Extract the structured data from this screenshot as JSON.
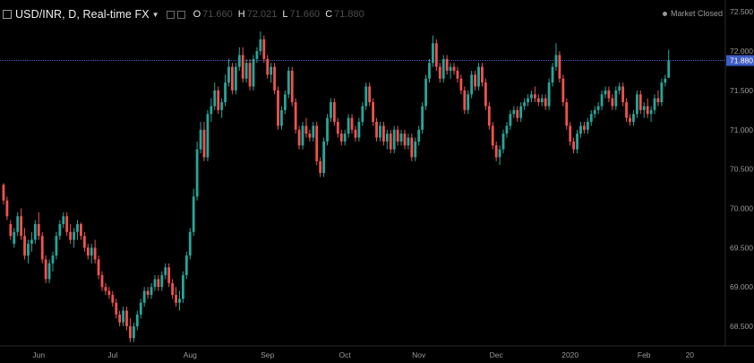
{
  "header": {
    "symbol": "USD/INR, D, Real-time FX",
    "open_label": "O",
    "open": "71.660",
    "high_label": "H",
    "high": "72.021",
    "low_label": "L",
    "low": "71.660",
    "close_label": "C",
    "close": "71.880",
    "status": "Market Closed"
  },
  "colors": {
    "up": "#26a69a",
    "down": "#ef5350",
    "background": "#000000",
    "price_line": "#4a60c8",
    "price_tag": "#3d5cc4"
  },
  "chart_data": {
    "type": "candlestick",
    "ylim": [
      68.25,
      72.65
    ],
    "y_ticks": [
      72.5,
      72.0,
      71.5,
      71.0,
      70.5,
      70.0,
      69.5,
      69.0,
      68.5
    ],
    "y_tick_labels": [
      "72.500",
      "72.000",
      "71.500",
      "71.000",
      "70.500",
      "70.000",
      "69.500",
      "69.000",
      "68.500"
    ],
    "x_labels": [
      "Jun",
      "Jul",
      "Aug",
      "Sep",
      "Oct",
      "Nov",
      "Dec",
      "2020",
      "Feb",
      "20"
    ],
    "x_label_index": [
      10,
      31,
      53,
      75,
      97,
      118,
      140,
      161,
      182,
      195
    ],
    "last_price": 71.88,
    "last_price_label": "71.880",
    "ohlc": [
      [
        70.3,
        70.32,
        70.05,
        70.1
      ],
      [
        70.1,
        70.15,
        69.85,
        69.9
      ],
      [
        69.8,
        69.85,
        69.6,
        69.65
      ],
      [
        69.55,
        69.75,
        69.5,
        69.7
      ],
      [
        69.7,
        69.95,
        69.65,
        69.9
      ],
      [
        69.9,
        70.0,
        69.6,
        69.65
      ],
      [
        69.65,
        69.75,
        69.35,
        69.4
      ],
      [
        69.4,
        69.6,
        69.3,
        69.55
      ],
      [
        69.55,
        69.7,
        69.45,
        69.6
      ],
      [
        69.6,
        69.85,
        69.55,
        69.8
      ],
      [
        69.8,
        69.95,
        69.6,
        69.65
      ],
      [
        69.65,
        69.7,
        69.3,
        69.35
      ],
      [
        69.35,
        69.4,
        69.05,
        69.1
      ],
      [
        69.1,
        69.35,
        69.05,
        69.3
      ],
      [
        69.3,
        69.45,
        69.2,
        69.4
      ],
      [
        69.4,
        69.7,
        69.35,
        69.65
      ],
      [
        69.65,
        69.85,
        69.6,
        69.8
      ],
      [
        69.8,
        69.95,
        69.75,
        69.9
      ],
      [
        69.9,
        69.95,
        69.65,
        69.7
      ],
      [
        69.7,
        69.8,
        69.55,
        69.6
      ],
      [
        69.6,
        69.75,
        69.5,
        69.7
      ],
      [
        69.7,
        69.85,
        69.6,
        69.8
      ],
      [
        69.8,
        69.82,
        69.6,
        69.65
      ],
      [
        69.65,
        69.7,
        69.45,
        69.5
      ],
      [
        69.5,
        69.55,
        69.35,
        69.4
      ],
      [
        69.4,
        69.55,
        69.3,
        69.5
      ],
      [
        69.5,
        69.6,
        69.3,
        69.35
      ],
      [
        69.35,
        69.4,
        69.1,
        69.15
      ],
      [
        69.15,
        69.2,
        68.95,
        69.0
      ],
      [
        69.0,
        69.05,
        68.9,
        68.95
      ],
      [
        68.95,
        69.0,
        68.85,
        68.9
      ],
      [
        68.9,
        68.95,
        68.75,
        68.8
      ],
      [
        68.8,
        68.85,
        68.6,
        68.65
      ],
      [
        68.65,
        68.7,
        68.5,
        68.55
      ],
      [
        68.55,
        68.75,
        68.5,
        68.7
      ],
      [
        68.7,
        68.75,
        68.45,
        68.5
      ],
      [
        68.5,
        68.6,
        68.3,
        68.35
      ],
      [
        68.35,
        68.55,
        68.3,
        68.5
      ],
      [
        68.5,
        68.7,
        68.45,
        68.65
      ],
      [
        68.65,
        68.85,
        68.6,
        68.8
      ],
      [
        68.8,
        69.0,
        68.75,
        68.95
      ],
      [
        68.95,
        69.0,
        68.85,
        68.9
      ],
      [
        68.9,
        69.05,
        68.85,
        69.0
      ],
      [
        69.0,
        69.15,
        68.95,
        69.1
      ],
      [
        69.1,
        69.15,
        68.95,
        69.0
      ],
      [
        69.0,
        69.2,
        68.95,
        69.15
      ],
      [
        69.15,
        69.3,
        69.1,
        69.25
      ],
      [
        69.25,
        69.3,
        69.0,
        69.05
      ],
      [
        69.05,
        69.1,
        68.85,
        68.9
      ],
      [
        68.9,
        69.0,
        68.75,
        68.8
      ],
      [
        68.8,
        68.95,
        68.7,
        68.85
      ],
      [
        68.85,
        69.2,
        68.8,
        69.15
      ],
      [
        69.15,
        69.45,
        69.1,
        69.4
      ],
      [
        69.4,
        69.75,
        69.35,
        69.7
      ],
      [
        69.7,
        70.25,
        69.65,
        70.15
      ],
      [
        70.15,
        70.85,
        70.1,
        70.75
      ],
      [
        70.75,
        71.1,
        70.7,
        71.0
      ],
      [
        71.0,
        71.1,
        70.6,
        70.65
      ],
      [
        70.65,
        71.25,
        70.6,
        71.2
      ],
      [
        71.2,
        71.4,
        71.1,
        71.3
      ],
      [
        71.3,
        71.6,
        71.25,
        71.5
      ],
      [
        71.5,
        71.55,
        71.2,
        71.25
      ],
      [
        71.25,
        71.4,
        71.15,
        71.35
      ],
      [
        71.35,
        71.7,
        71.3,
        71.6
      ],
      [
        71.6,
        71.9,
        71.55,
        71.8
      ],
      [
        71.8,
        71.85,
        71.45,
        71.5
      ],
      [
        71.5,
        71.85,
        71.45,
        71.8
      ],
      [
        71.8,
        72.05,
        71.75,
        71.95
      ],
      [
        71.95,
        72.05,
        71.6,
        71.65
      ],
      [
        71.65,
        71.9,
        71.6,
        71.85
      ],
      [
        71.85,
        71.9,
        71.5,
        71.55
      ],
      [
        71.55,
        71.95,
        71.5,
        71.9
      ],
      [
        71.9,
        72.05,
        71.85,
        72.0
      ],
      [
        72.0,
        72.25,
        71.95,
        72.15
      ],
      [
        72.15,
        72.2,
        71.85,
        71.9
      ],
      [
        71.9,
        71.95,
        71.65,
        71.7
      ],
      [
        71.7,
        71.85,
        71.6,
        71.8
      ],
      [
        71.8,
        71.85,
        71.45,
        71.5
      ],
      [
        71.5,
        71.55,
        71.0,
        71.05
      ],
      [
        71.05,
        71.3,
        71.0,
        71.25
      ],
      [
        71.25,
        71.5,
        71.2,
        71.45
      ],
      [
        71.45,
        71.8,
        71.4,
        71.75
      ],
      [
        71.75,
        71.8,
        71.3,
        71.35
      ],
      [
        71.35,
        71.4,
        70.95,
        71.0
      ],
      [
        71.0,
        71.05,
        70.75,
        70.8
      ],
      [
        70.8,
        71.1,
        70.75,
        71.05
      ],
      [
        71.05,
        71.15,
        70.9,
        70.95
      ],
      [
        70.95,
        71.0,
        70.85,
        70.9
      ],
      [
        70.9,
        71.1,
        70.85,
        71.05
      ],
      [
        71.05,
        71.1,
        70.55,
        70.6
      ],
      [
        70.6,
        70.65,
        70.4,
        70.45
      ],
      [
        70.45,
        70.9,
        70.4,
        70.85
      ],
      [
        70.85,
        71.2,
        70.8,
        71.15
      ],
      [
        71.15,
        71.4,
        71.1,
        71.35
      ],
      [
        71.35,
        71.4,
        71.05,
        71.1
      ],
      [
        71.1,
        71.15,
        70.9,
        70.95
      ],
      [
        70.95,
        71.0,
        70.8,
        70.85
      ],
      [
        70.85,
        71.0,
        70.8,
        70.95
      ],
      [
        70.95,
        71.2,
        70.9,
        71.15
      ],
      [
        71.15,
        71.2,
        70.95,
        71.0
      ],
      [
        71.0,
        71.05,
        70.85,
        70.9
      ],
      [
        70.9,
        71.15,
        70.85,
        71.1
      ],
      [
        71.1,
        71.35,
        71.05,
        71.3
      ],
      [
        71.3,
        71.6,
        71.25,
        71.55
      ],
      [
        71.55,
        71.6,
        71.3,
        71.35
      ],
      [
        71.35,
        71.4,
        71.05,
        71.1
      ],
      [
        71.1,
        71.15,
        70.85,
        70.9
      ],
      [
        70.9,
        71.1,
        70.85,
        71.05
      ],
      [
        71.05,
        71.1,
        70.8,
        70.85
      ],
      [
        70.85,
        71.0,
        70.75,
        70.95
      ],
      [
        70.95,
        71.0,
        70.7,
        70.75
      ],
      [
        70.75,
        71.05,
        70.7,
        71.0
      ],
      [
        71.0,
        71.05,
        70.8,
        70.85
      ],
      [
        70.85,
        71.0,
        70.8,
        70.95
      ],
      [
        70.95,
        71.0,
        70.75,
        70.8
      ],
      [
        70.8,
        70.95,
        70.75,
        70.9
      ],
      [
        70.9,
        70.95,
        70.6,
        70.65
      ],
      [
        70.65,
        70.9,
        70.6,
        70.85
      ],
      [
        70.85,
        71.05,
        70.8,
        71.0
      ],
      [
        71.0,
        71.35,
        70.95,
        71.3
      ],
      [
        71.3,
        71.7,
        71.25,
        71.65
      ],
      [
        71.65,
        71.9,
        71.6,
        71.85
      ],
      [
        71.85,
        72.2,
        71.8,
        72.1
      ],
      [
        72.1,
        72.15,
        71.75,
        71.8
      ],
      [
        71.8,
        71.85,
        71.6,
        71.65
      ],
      [
        71.65,
        71.95,
        71.6,
        71.9
      ],
      [
        71.9,
        71.95,
        71.7,
        71.75
      ],
      [
        71.75,
        71.85,
        71.65,
        71.8
      ],
      [
        71.8,
        71.85,
        71.7,
        71.75
      ],
      [
        71.75,
        71.8,
        71.6,
        71.65
      ],
      [
        71.65,
        71.7,
        71.45,
        71.5
      ],
      [
        71.5,
        71.55,
        71.2,
        71.25
      ],
      [
        71.25,
        71.5,
        71.2,
        71.45
      ],
      [
        71.45,
        71.75,
        71.4,
        71.7
      ],
      [
        71.7,
        71.75,
        71.5,
        71.55
      ],
      [
        71.55,
        71.85,
        71.5,
        71.8
      ],
      [
        71.8,
        71.85,
        71.55,
        71.6
      ],
      [
        71.6,
        71.65,
        71.25,
        71.3
      ],
      [
        71.3,
        71.35,
        71.0,
        71.05
      ],
      [
        71.05,
        71.1,
        70.75,
        70.8
      ],
      [
        70.8,
        70.85,
        70.6,
        70.65
      ],
      [
        70.65,
        70.8,
        70.55,
        70.75
      ],
      [
        70.75,
        71.0,
        70.7,
        70.95
      ],
      [
        70.95,
        71.1,
        70.9,
        71.05
      ],
      [
        71.05,
        71.25,
        71.0,
        71.2
      ],
      [
        71.2,
        71.3,
        71.15,
        71.25
      ],
      [
        71.25,
        71.3,
        71.1,
        71.15
      ],
      [
        71.15,
        71.35,
        71.1,
        71.3
      ],
      [
        71.3,
        71.4,
        71.25,
        71.35
      ],
      [
        71.35,
        71.45,
        71.3,
        71.4
      ],
      [
        71.4,
        71.5,
        71.35,
        71.45
      ],
      [
        71.45,
        71.55,
        71.35,
        71.4
      ],
      [
        71.4,
        71.45,
        71.3,
        71.35
      ],
      [
        71.35,
        71.45,
        71.3,
        71.4
      ],
      [
        71.4,
        71.45,
        71.25,
        71.3
      ],
      [
        71.3,
        71.65,
        71.25,
        71.6
      ],
      [
        71.6,
        71.85,
        71.55,
        71.8
      ],
      [
        71.8,
        72.1,
        71.75,
        71.95
      ],
      [
        71.95,
        72.0,
        71.6,
        71.65
      ],
      [
        71.65,
        71.7,
        71.3,
        71.35
      ],
      [
        71.35,
        71.4,
        71.0,
        71.05
      ],
      [
        71.05,
        71.1,
        70.8,
        70.85
      ],
      [
        70.85,
        70.9,
        70.7,
        70.75
      ],
      [
        70.75,
        71.0,
        70.7,
        70.95
      ],
      [
        70.95,
        71.1,
        70.9,
        71.05
      ],
      [
        71.05,
        71.1,
        70.95,
        71.0
      ],
      [
        71.0,
        71.15,
        70.95,
        71.1
      ],
      [
        71.1,
        71.25,
        71.05,
        71.2
      ],
      [
        71.2,
        71.3,
        71.15,
        71.25
      ],
      [
        71.25,
        71.35,
        71.2,
        71.3
      ],
      [
        71.3,
        71.5,
        71.25,
        71.45
      ],
      [
        71.45,
        71.55,
        71.4,
        71.5
      ],
      [
        71.5,
        71.55,
        71.35,
        71.4
      ],
      [
        71.4,
        71.45,
        71.25,
        71.3
      ],
      [
        71.3,
        71.55,
        71.25,
        71.5
      ],
      [
        71.5,
        71.6,
        71.45,
        71.55
      ],
      [
        71.55,
        71.6,
        71.3,
        71.35
      ],
      [
        71.35,
        71.4,
        71.1,
        71.15
      ],
      [
        71.15,
        71.2,
        71.05,
        71.1
      ],
      [
        71.1,
        71.25,
        71.05,
        71.2
      ],
      [
        71.2,
        71.5,
        71.15,
        71.45
      ],
      [
        71.45,
        71.5,
        71.2,
        71.25
      ],
      [
        71.25,
        71.35,
        71.15,
        71.3
      ],
      [
        71.3,
        71.4,
        71.15,
        71.2
      ],
      [
        71.2,
        71.3,
        71.1,
        71.25
      ],
      [
        71.25,
        71.45,
        71.2,
        71.4
      ],
      [
        71.4,
        71.5,
        71.3,
        71.35
      ],
      [
        71.35,
        71.65,
        71.3,
        71.6
      ],
      [
        71.6,
        71.7,
        71.55,
        71.65
      ],
      [
        71.66,
        72.02,
        71.66,
        71.88
      ]
    ]
  }
}
